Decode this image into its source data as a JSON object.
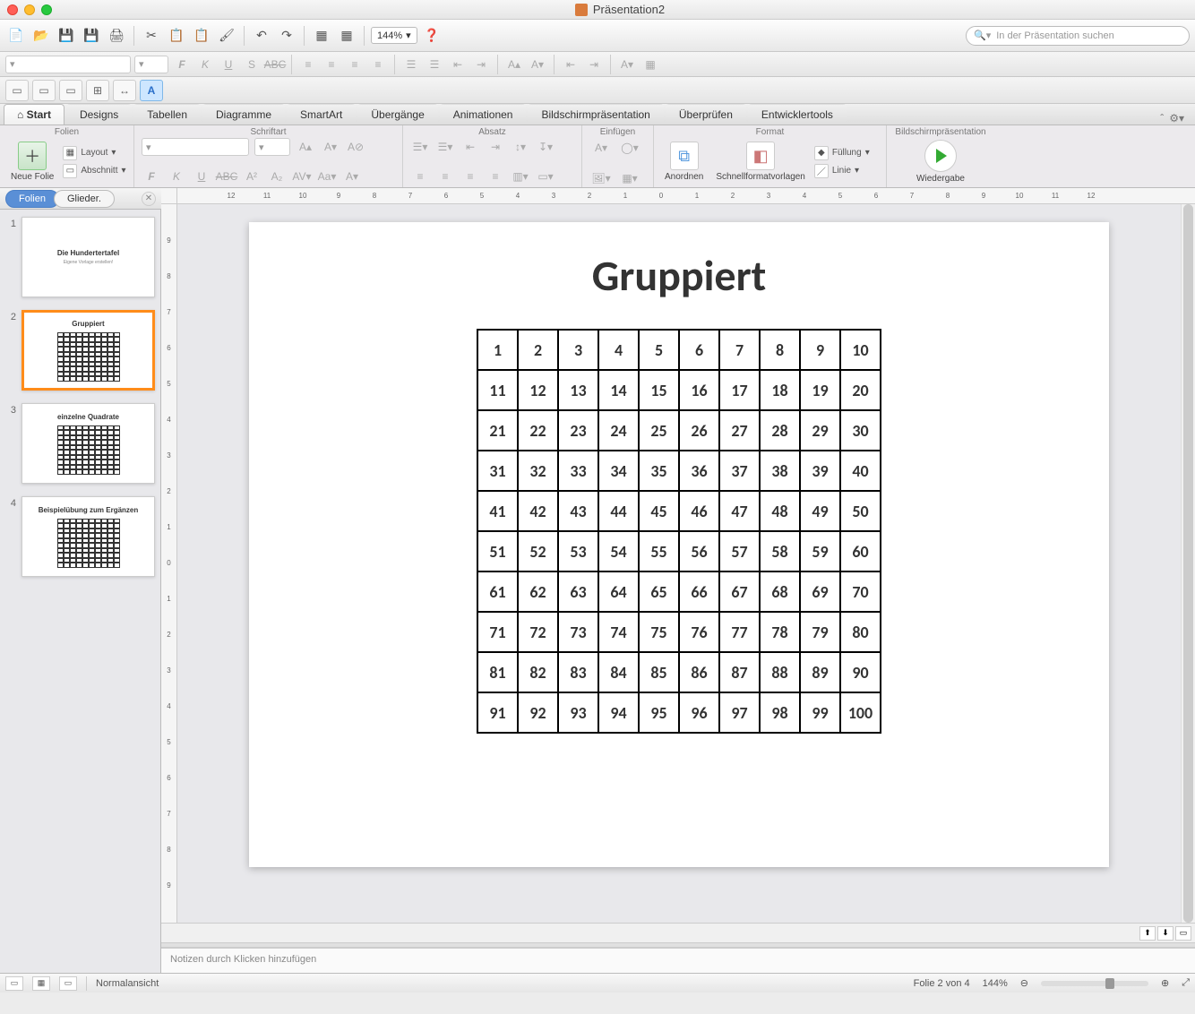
{
  "window": {
    "title": "Präsentation2"
  },
  "toolbar1": {
    "zoom": "144%"
  },
  "search": {
    "placeholder": "In der Präsentation suchen"
  },
  "ribbonTabs": [
    {
      "label": "Start",
      "active": true
    },
    {
      "label": "Designs"
    },
    {
      "label": "Tabellen"
    },
    {
      "label": "Diagramme"
    },
    {
      "label": "SmartArt"
    },
    {
      "label": "Übergänge"
    },
    {
      "label": "Animationen"
    },
    {
      "label": "Bildschirmpräsentation"
    },
    {
      "label": "Überprüfen"
    },
    {
      "label": "Entwicklertools"
    }
  ],
  "ribbon": {
    "groups": {
      "folien": {
        "label": "Folien",
        "neue": "Neue Folie",
        "layout": "Layout",
        "abschnitt": "Abschnitt"
      },
      "schriftart": {
        "label": "Schriftart"
      },
      "absatz": {
        "label": "Absatz"
      },
      "einfuegen": {
        "label": "Einfügen"
      },
      "format": {
        "label": "Format",
        "anordnen": "Anordnen",
        "schnell": "Schnellformatvorlagen",
        "fuellung": "Füllung",
        "linie": "Linie"
      },
      "praesentation": {
        "label": "Bildschirmpräsentation",
        "wiedergabe": "Wiedergabe"
      }
    }
  },
  "panelTabs": {
    "folien": "Folien",
    "glieder": "Glieder."
  },
  "thumbnails": [
    {
      "num": "1",
      "title": "Die Hundertertafel",
      "sub": "Eigene Vorlage erstellen!",
      "grid": false
    },
    {
      "num": "2",
      "title": "Gruppiert",
      "sub": "",
      "grid": true,
      "selected": true
    },
    {
      "num": "3",
      "title": "einzelne Quadrate",
      "sub": "",
      "grid": true
    },
    {
      "num": "4",
      "title": "Beispielübung zum Ergänzen",
      "sub": "",
      "grid": true
    }
  ],
  "slide": {
    "title": "Gruppiert",
    "grid": {
      "rows": 10,
      "cols": 10,
      "start": 1
    }
  },
  "rulerH": [
    "12",
    "11",
    "10",
    "9",
    "8",
    "7",
    "6",
    "5",
    "4",
    "3",
    "2",
    "1",
    "0",
    "1",
    "2",
    "3",
    "4",
    "5",
    "6",
    "7",
    "8",
    "9",
    "10",
    "11",
    "12"
  ],
  "rulerV": [
    "9",
    "8",
    "7",
    "6",
    "5",
    "4",
    "3",
    "2",
    "1",
    "0",
    "1",
    "2",
    "3",
    "4",
    "5",
    "6",
    "7",
    "8",
    "9"
  ],
  "notes": {
    "placeholder": "Notizen durch Klicken hinzufügen"
  },
  "status": {
    "view": "Normalansicht",
    "slide": "Folie 2 von 4",
    "zoom": "144%"
  }
}
